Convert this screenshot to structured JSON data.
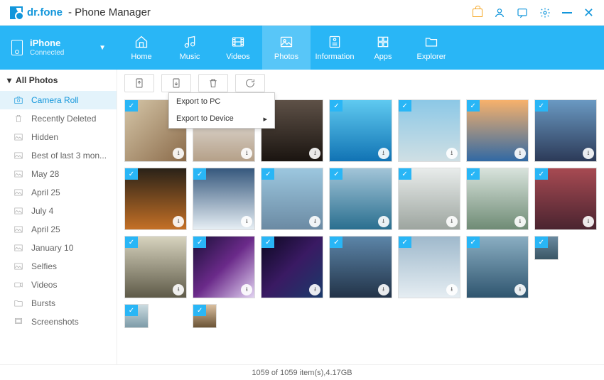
{
  "app": {
    "name": "dr.fone",
    "suffix": "- Phone Manager"
  },
  "device": {
    "name": "iPhone",
    "status": "Connected"
  },
  "nav": [
    {
      "label": "Home"
    },
    {
      "label": "Music"
    },
    {
      "label": "Videos"
    },
    {
      "label": "Photos"
    },
    {
      "label": "Information"
    },
    {
      "label": "Apps"
    },
    {
      "label": "Explorer"
    }
  ],
  "sidebar": {
    "header": "All Photos",
    "items": [
      {
        "label": "Camera Roll",
        "icon": "camera"
      },
      {
        "label": "Recently Deleted",
        "icon": "trash"
      },
      {
        "label": "Hidden",
        "icon": "photo"
      },
      {
        "label": "Best of last 3 mon...",
        "icon": "photo"
      },
      {
        "label": "May 28",
        "icon": "photo"
      },
      {
        "label": "April 25",
        "icon": "photo"
      },
      {
        "label": "July 4",
        "icon": "photo"
      },
      {
        "label": "April 25",
        "icon": "photo"
      },
      {
        "label": "January 10",
        "icon": "photo"
      },
      {
        "label": "Selfies",
        "icon": "photo"
      },
      {
        "label": "Videos",
        "icon": "video"
      },
      {
        "label": "Bursts",
        "icon": "folder"
      },
      {
        "label": "Screenshots",
        "icon": "screen"
      }
    ]
  },
  "export_menu": {
    "item1": "Export to PC",
    "item2": "Export to Device"
  },
  "status": "1059 of 1059 item(s),4.17GB"
}
